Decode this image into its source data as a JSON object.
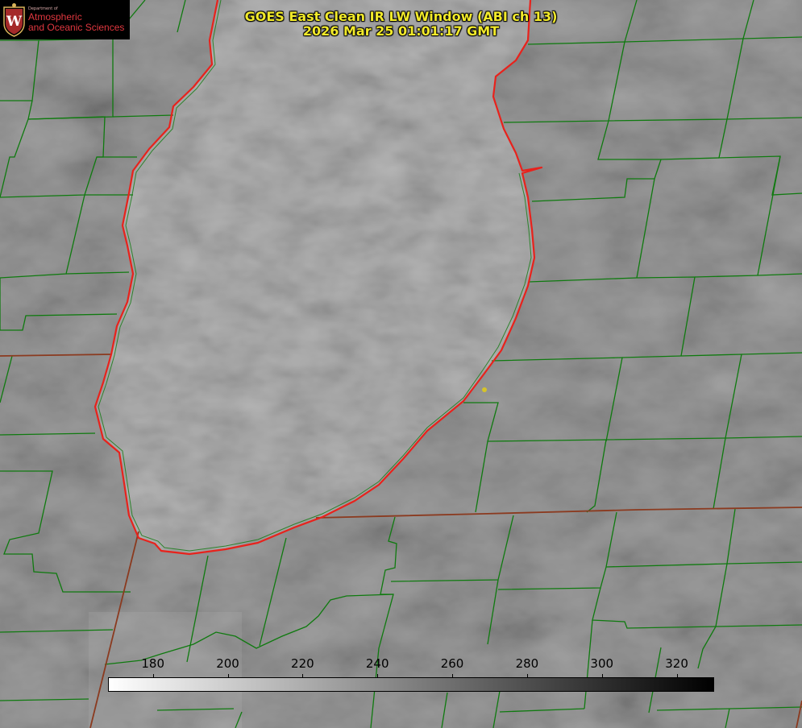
{
  "image_title": {
    "line1": "GOES East Clean IR LW Window (ABI ch 13)",
    "line2": "2026 Mar 25 01:01:17 GMT"
  },
  "logo": {
    "department": "Department of",
    "line1": "Atmospheric",
    "line2": "and Oceanic Sciences",
    "seal_letter": "W",
    "seal_color": "#a52a2a"
  },
  "colorbar": {
    "unit": "",
    "min": 168,
    "max": 330,
    "ticks": [
      180,
      200,
      220,
      240,
      260,
      280,
      300,
      320
    ],
    "color_low": "#ffffff",
    "color_high": "#000000"
  },
  "map_style": {
    "county_lines": "#0f7a0f",
    "state_lines": "#8b3a1f",
    "shoreline": "#e8221c",
    "marker": "#d6c428",
    "cloud_base": "#7a7a7a"
  },
  "marker": {
    "name": "station-dot"
  }
}
